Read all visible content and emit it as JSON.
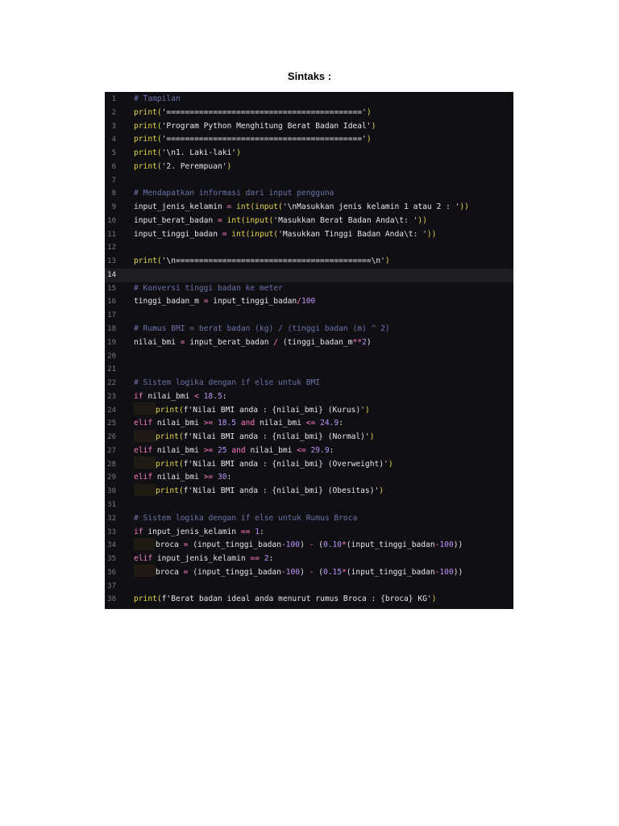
{
  "page": {
    "title": "Sintaks :"
  },
  "editor": {
    "current_line": 14,
    "colors": {
      "background": "#101014",
      "comment": "#6b73a8",
      "function": "#e5d54b",
      "keyword": "#ff79c6",
      "number": "#bd93f9",
      "text": "#e6e6e6"
    },
    "lines": [
      {
        "n": "1",
        "indent": 0,
        "tokens": [
          [
            "comment",
            "# Tampilan"
          ]
        ]
      },
      {
        "n": "2",
        "indent": 0,
        "tokens": [
          [
            "func",
            "print("
          ],
          [
            "str",
            "'=========================================='"
          ],
          [
            "func",
            ")"
          ]
        ]
      },
      {
        "n": "3",
        "indent": 0,
        "tokens": [
          [
            "func",
            "print("
          ],
          [
            "str",
            "'Program Python Menghitung Berat Badan Ideal'"
          ],
          [
            "func",
            ")"
          ]
        ]
      },
      {
        "n": "4",
        "indent": 0,
        "tokens": [
          [
            "func",
            "print("
          ],
          [
            "str",
            "'=========================================='"
          ],
          [
            "func",
            ")"
          ]
        ]
      },
      {
        "n": "5",
        "indent": 0,
        "tokens": [
          [
            "func",
            "print("
          ],
          [
            "str",
            "'\\n1. Laki-laki'"
          ],
          [
            "func",
            ")"
          ]
        ]
      },
      {
        "n": "6",
        "indent": 0,
        "tokens": [
          [
            "func",
            "print("
          ],
          [
            "str",
            "'2. Perempuan'"
          ],
          [
            "func",
            ")"
          ]
        ]
      },
      {
        "n": "7",
        "indent": 0,
        "tokens": []
      },
      {
        "n": "8",
        "indent": 0,
        "tokens": [
          [
            "comment",
            "# Mendapatkan informasi dari input pengguna"
          ]
        ]
      },
      {
        "n": "9",
        "indent": 0,
        "tokens": [
          [
            "ident",
            "input_jenis_kelamin"
          ],
          [
            "op",
            " = "
          ],
          [
            "func",
            "int(input("
          ],
          [
            "str",
            "'\\nMasukkan jenis kelamin 1 atau 2 : '"
          ],
          [
            "func",
            "))"
          ]
        ]
      },
      {
        "n": "10",
        "indent": 0,
        "tokens": [
          [
            "ident",
            "input_berat_badan"
          ],
          [
            "op",
            " = "
          ],
          [
            "func",
            "int(input("
          ],
          [
            "str",
            "'Masukkan Berat Badan Anda\\t: '"
          ],
          [
            "func",
            "))"
          ]
        ]
      },
      {
        "n": "11",
        "indent": 0,
        "tokens": [
          [
            "ident",
            "input_tinggi_badan"
          ],
          [
            "op",
            " = "
          ],
          [
            "func",
            "int(input("
          ],
          [
            "str",
            "'Masukkan Tinggi Badan Anda\\t: '"
          ],
          [
            "func",
            "))"
          ]
        ]
      },
      {
        "n": "12",
        "indent": 0,
        "tokens": []
      },
      {
        "n": "13",
        "indent": 0,
        "tokens": [
          [
            "func",
            "print("
          ],
          [
            "str",
            "'\\n==========================================\\n'"
          ],
          [
            "func",
            ")"
          ]
        ]
      },
      {
        "n": "14",
        "indent": 0,
        "tokens": []
      },
      {
        "n": "15",
        "indent": 0,
        "tokens": [
          [
            "comment",
            "# Konversi tinggi badan ke meter"
          ]
        ]
      },
      {
        "n": "16",
        "indent": 0,
        "tokens": [
          [
            "ident",
            "tinggi_badan_m"
          ],
          [
            "op",
            " = "
          ],
          [
            "ident",
            "input_tinggi_badan"
          ],
          [
            "op",
            "/"
          ],
          [
            "num",
            "100"
          ]
        ]
      },
      {
        "n": "17",
        "indent": 0,
        "tokens": []
      },
      {
        "n": "18",
        "indent": 0,
        "tokens": [
          [
            "comment",
            "# Rumus BMI = berat badan (kg) / (tinggi badan (m) ^ 2)"
          ]
        ]
      },
      {
        "n": "19",
        "indent": 0,
        "tokens": [
          [
            "ident",
            "nilai_bmi"
          ],
          [
            "op",
            " = "
          ],
          [
            "ident",
            "input_berat_badan"
          ],
          [
            "op",
            " / "
          ],
          [
            "plain",
            "("
          ],
          [
            "ident",
            "tinggi_badan_m"
          ],
          [
            "op",
            "**"
          ],
          [
            "num",
            "2"
          ],
          [
            "plain",
            ")"
          ]
        ]
      },
      {
        "n": "20",
        "indent": 0,
        "tokens": []
      },
      {
        "n": "21",
        "indent": 0,
        "tokens": []
      },
      {
        "n": "22",
        "indent": 0,
        "tokens": [
          [
            "comment",
            "# Sistem logika dengan if else untuk BMI"
          ]
        ]
      },
      {
        "n": "23",
        "indent": 0,
        "tokens": [
          [
            "kw",
            "if "
          ],
          [
            "ident",
            "nilai_bmi"
          ],
          [
            "op",
            " < "
          ],
          [
            "num",
            "18.5"
          ],
          [
            "plain",
            ":"
          ]
        ]
      },
      {
        "n": "24",
        "indent": 1,
        "tokens": [
          [
            "func",
            "print("
          ],
          [
            "str",
            "f'Nilai BMI anda : {nilai_bmi} (Kurus)'"
          ],
          [
            "func",
            ")"
          ]
        ]
      },
      {
        "n": "25",
        "indent": 0,
        "tokens": [
          [
            "kw",
            "elif "
          ],
          [
            "ident",
            "nilai_bmi"
          ],
          [
            "op",
            " >= "
          ],
          [
            "num",
            "18.5"
          ],
          [
            "kw",
            " and "
          ],
          [
            "ident",
            "nilai_bmi"
          ],
          [
            "op",
            " <= "
          ],
          [
            "num",
            "24.9"
          ],
          [
            "plain",
            ":"
          ]
        ]
      },
      {
        "n": "26",
        "indent": 1,
        "tokens": [
          [
            "func",
            "print("
          ],
          [
            "str",
            "f'Nilai BMI anda : {nilai_bmi} (Normal)'"
          ],
          [
            "func",
            ")"
          ]
        ]
      },
      {
        "n": "27",
        "indent": 0,
        "tokens": [
          [
            "kw",
            "elif "
          ],
          [
            "ident",
            "nilai_bmi"
          ],
          [
            "op",
            " >= "
          ],
          [
            "num",
            "25"
          ],
          [
            "kw",
            " and "
          ],
          [
            "ident",
            "nilai_bmi"
          ],
          [
            "op",
            " <= "
          ],
          [
            "num",
            "29.9"
          ],
          [
            "plain",
            ":"
          ]
        ]
      },
      {
        "n": "28",
        "indent": 1,
        "tokens": [
          [
            "func",
            "print("
          ],
          [
            "str",
            "f'Nilai BMI anda : {nilai_bmi} (Overweight)'"
          ],
          [
            "func",
            ")"
          ]
        ]
      },
      {
        "n": "29",
        "indent": 0,
        "tokens": [
          [
            "kw",
            "elif "
          ],
          [
            "ident",
            "nilai_bmi"
          ],
          [
            "op",
            " >= "
          ],
          [
            "num",
            "30"
          ],
          [
            "plain",
            ":"
          ]
        ]
      },
      {
        "n": "30",
        "indent": 1,
        "tokens": [
          [
            "func",
            "print("
          ],
          [
            "str",
            "f'Nilai BMI anda : {nilai_bmi} (Obesitas)'"
          ],
          [
            "func",
            ")"
          ]
        ]
      },
      {
        "n": "31",
        "indent": 0,
        "tokens": []
      },
      {
        "n": "32",
        "indent": 0,
        "tokens": [
          [
            "comment",
            "# Sistem logika dengan if else untuk Rumus Broca"
          ]
        ]
      },
      {
        "n": "33",
        "indent": 0,
        "tokens": [
          [
            "kw",
            "if "
          ],
          [
            "ident",
            "input_jenis_kelamin"
          ],
          [
            "op",
            " == "
          ],
          [
            "num",
            "1"
          ],
          [
            "plain",
            ":"
          ]
        ]
      },
      {
        "n": "34",
        "indent": 1,
        "tokens": [
          [
            "ident",
            "broca"
          ],
          [
            "op",
            " = "
          ],
          [
            "plain",
            "("
          ],
          [
            "ident",
            "input_tinggi_badan"
          ],
          [
            "op",
            "-"
          ],
          [
            "num",
            "100"
          ],
          [
            "plain",
            ")"
          ],
          [
            "op",
            " - "
          ],
          [
            "plain",
            "("
          ],
          [
            "num",
            "0.10"
          ],
          [
            "op",
            "*"
          ],
          [
            "plain",
            "("
          ],
          [
            "ident",
            "input_tinggi_badan"
          ],
          [
            "op",
            "-"
          ],
          [
            "num",
            "100"
          ],
          [
            "plain",
            "))"
          ]
        ]
      },
      {
        "n": "35",
        "indent": 0,
        "tokens": [
          [
            "kw",
            "elif "
          ],
          [
            "ident",
            "input_jenis_kelamin"
          ],
          [
            "op",
            " == "
          ],
          [
            "num",
            "2"
          ],
          [
            "plain",
            ":"
          ]
        ]
      },
      {
        "n": "36",
        "indent": 1,
        "tokens": [
          [
            "ident",
            "broca"
          ],
          [
            "op",
            " = "
          ],
          [
            "plain",
            "("
          ],
          [
            "ident",
            "input_tinggi_badan"
          ],
          [
            "op",
            "-"
          ],
          [
            "num",
            "100"
          ],
          [
            "plain",
            ")"
          ],
          [
            "op",
            " - "
          ],
          [
            "plain",
            "("
          ],
          [
            "num",
            "0.15"
          ],
          [
            "op",
            "*"
          ],
          [
            "plain",
            "("
          ],
          [
            "ident",
            "input_tinggi_badan"
          ],
          [
            "op",
            "-"
          ],
          [
            "num",
            "100"
          ],
          [
            "plain",
            "))"
          ]
        ]
      },
      {
        "n": "37",
        "indent": 0,
        "tokens": []
      },
      {
        "n": "38",
        "indent": 0,
        "tokens": [
          [
            "func",
            "print("
          ],
          [
            "str",
            "f'Berat badan ideal anda menurut rumus Broca : {broca} KG'"
          ],
          [
            "func",
            ")"
          ]
        ]
      }
    ]
  }
}
